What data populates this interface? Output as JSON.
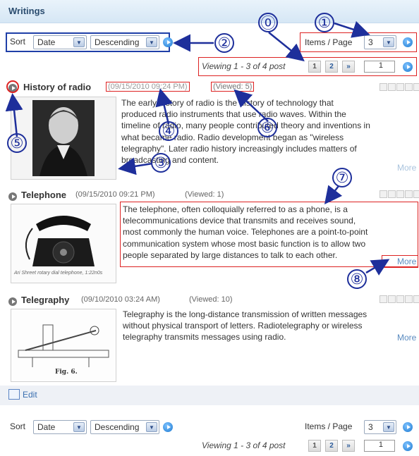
{
  "widget_title": "Writings",
  "sort": {
    "label": "Sort",
    "field": "Date",
    "order": "Descending"
  },
  "items_per_page": {
    "label": "Items / Page",
    "value": "3"
  },
  "pagination": {
    "viewing": "Viewing 1 - 3 of 4 post",
    "page1": "1",
    "page2": "2",
    "next": "»",
    "jump_value": "1"
  },
  "posts": [
    {
      "title": "History of radio",
      "date": "(09/15/2010 09:24 PM)",
      "views": "(Viewed: 5)",
      "lines": [
        "The early history of radio is the history of technology that",
        "produced radio instruments that use radio waves. Within the",
        "timeline of radio, many people contributed theory and inventions in",
        "what became radio. Radio development began as \"wireless",
        "telegraphy\". Later radio history increasingly includes matters of",
        "broadcasting and content."
      ],
      "more": "More"
    },
    {
      "title": "Telephone",
      "date": "(09/15/2010 09:21 PM)",
      "views": "(Viewed: 1)",
      "lines": [
        "The telephone, often colloquially referred to as a phone, is a",
        "telecommunications device that transmits and receives sound,",
        "most commonly the human voice. Telephones are a point-to-point",
        "communication system whose most basic function is to allow two",
        "people separated by large distances to talk to each other."
      ],
      "more": "More",
      "image_caption": "Ari Shreet rotary dial telephone, 1:22n0s"
    },
    {
      "title": "Telegraphy",
      "date": "(09/10/2010 03:24 AM)",
      "views": "(Viewed: 10)",
      "lines": [
        "Telegraphy is the long-distance transmission of written messages",
        "without physical transport of letters. Radiotelegraphy or wireless",
        "telegraphy transmits messages using radio."
      ],
      "more": "More",
      "image_caption": "Fig. 6."
    }
  ],
  "edit_label": "Edit",
  "callouts": [
    "⓪",
    "①",
    "②",
    "③",
    "④",
    "⑤",
    "⑥",
    "⑦",
    "⑧"
  ],
  "colors": {
    "header_bg": "#d6e7f5",
    "link": "#5a8bc0",
    "callout_red": "#dd2222",
    "callout_blue": "#1e2f9b"
  }
}
